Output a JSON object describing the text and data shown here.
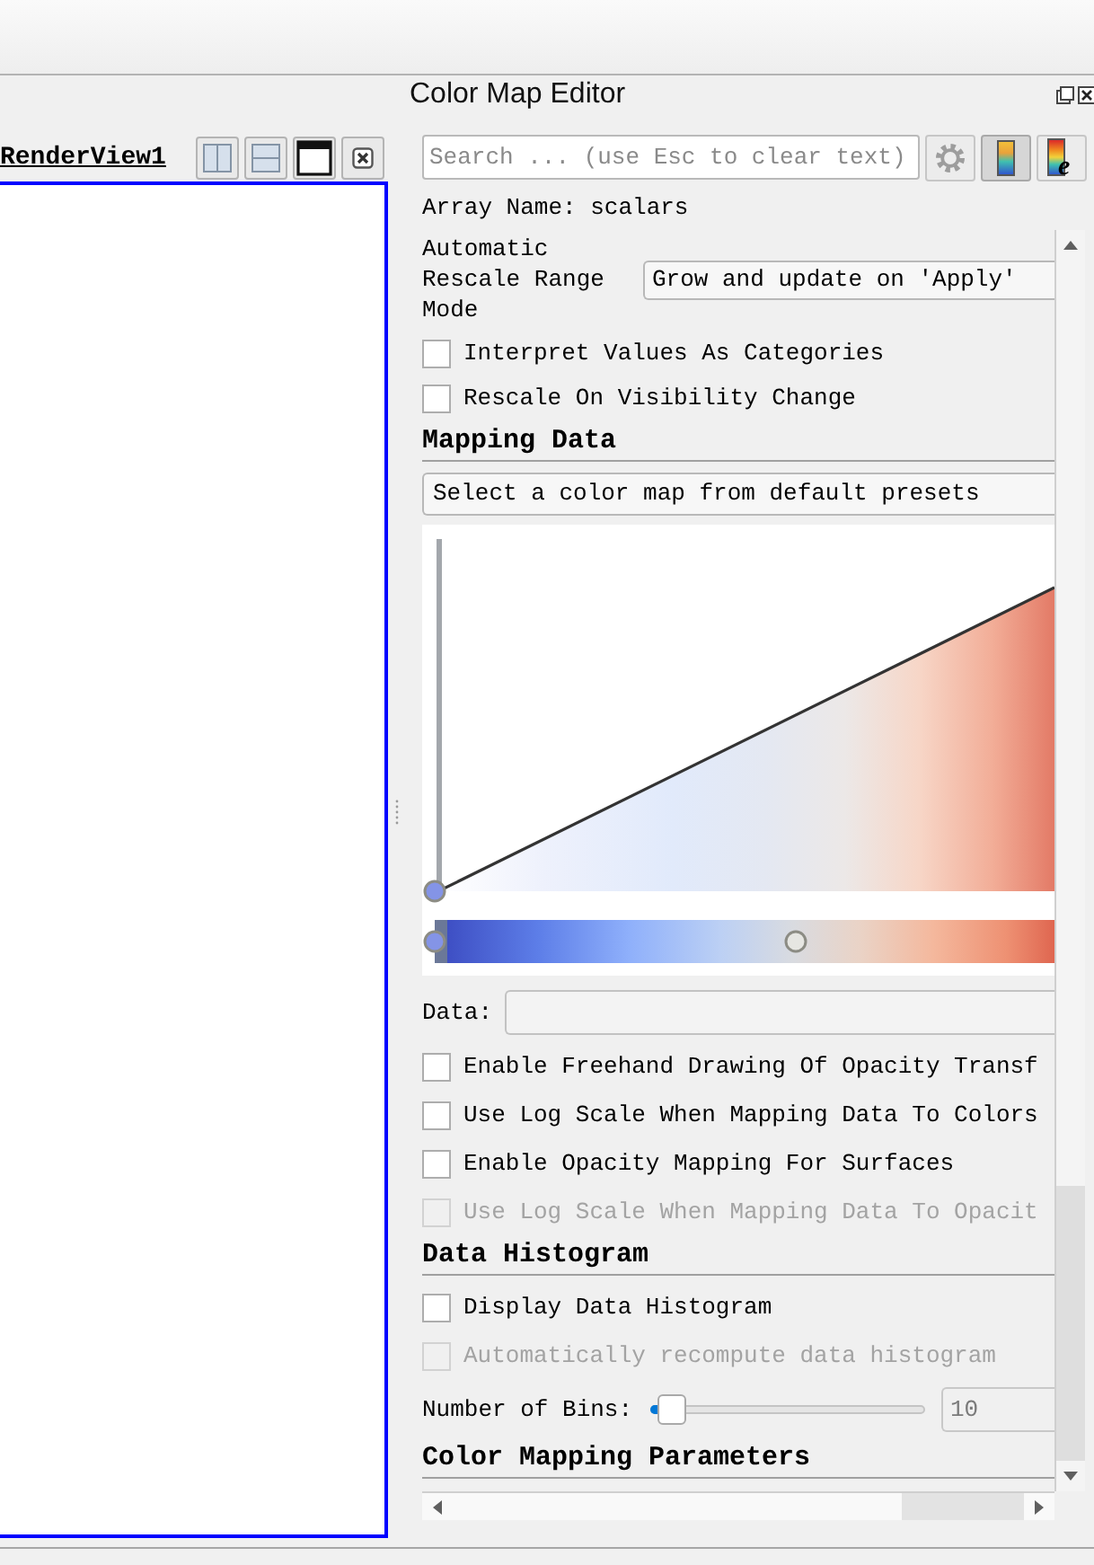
{
  "render_view": {
    "title": "RenderView1"
  },
  "color_map_editor": {
    "title": "Color Map Editor",
    "search": {
      "placeholder": "Search ... (use Esc to clear text)"
    },
    "tool_buttons": [
      {
        "kind": "settings",
        "pressed": false
      },
      {
        "kind": "colormap",
        "pressed": true
      },
      {
        "kind": "colormap_edit",
        "pressed": false,
        "glyph": "e"
      }
    ],
    "array_name": "Array Name: scalars",
    "rescale_mode": {
      "label": "Automatic Rescale Range Mode",
      "value": "Grow and update on 'Apply'"
    },
    "options": [
      {
        "label": "Interpret Values As Categories",
        "checked": false,
        "disabled": false
      },
      {
        "label": "Rescale On Visibility Change",
        "checked": false,
        "disabled": false
      }
    ],
    "sections": [
      {
        "title": "Mapping Data",
        "items": [
          {
            "kind": "dropdown",
            "value": "Select a color map from default presets"
          },
          {
            "kind": "transfer_editor"
          },
          {
            "kind": "field",
            "label": "Data:"
          },
          {
            "kind": "checkbox",
            "label": "Enable Freehand Drawing Of Opacity Transf",
            "checked": false,
            "disabled": false
          },
          {
            "kind": "checkbox",
            "label": "Use Log Scale When Mapping Data To Colors",
            "checked": false,
            "disabled": false
          },
          {
            "kind": "checkbox",
            "label": "Enable Opacity Mapping For Surfaces",
            "checked": false,
            "disabled": false
          },
          {
            "kind": "checkbox",
            "label": "Use Log Scale When Mapping Data To Opacit",
            "checked": false,
            "disabled": true
          }
        ]
      },
      {
        "title": "Data Histogram",
        "items": [
          {
            "kind": "checkbox",
            "label": "Display Data Histogram",
            "checked": false,
            "disabled": false
          },
          {
            "kind": "checkbox",
            "label": "Automatically recompute data histogram",
            "checked": false,
            "disabled": true
          },
          {
            "kind": "slider",
            "label": "Number of Bins:",
            "level": 0.03,
            "value": "10"
          }
        ]
      },
      {
        "title": "Color Mapping Parameters"
      }
    ]
  }
}
